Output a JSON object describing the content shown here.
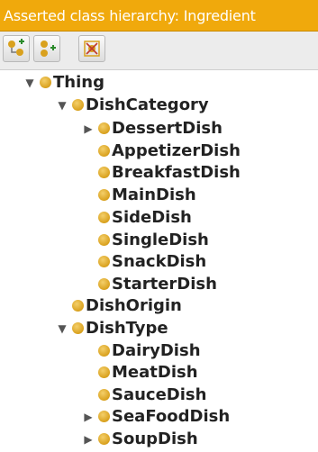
{
  "panel": {
    "title": "Asserted class hierarchy: Ingredient"
  },
  "toolbar": {
    "buttons": [
      {
        "icon": "add-subclass-icon"
      },
      {
        "icon": "add-sibling-icon"
      },
      {
        "icon": "delete-class-icon"
      }
    ]
  },
  "tree": {
    "root": "Thing",
    "dish_category": "DishCategory",
    "dessert_dish": "DessertDish",
    "appetizer_dish": "AppetizerDish",
    "breakfast_dish": "BreakfastDish",
    "main_dish": "MainDish",
    "side_dish": "SideDish",
    "single_dish": "SingleDish",
    "snack_dish": "SnackDish",
    "starter_dish": "StarterDish",
    "dish_origin": "DishOrigin",
    "dish_type": "DishType",
    "dairy_dish": "DairyDish",
    "meat_dish": "MeatDish",
    "sauce_dish": "SauceDish",
    "seafood_dish": "SeaFoodDish",
    "soup_dish": "SoupDish"
  },
  "colors": {
    "title_bar": "#f0a90c",
    "class_icon": "#d9a11e"
  }
}
